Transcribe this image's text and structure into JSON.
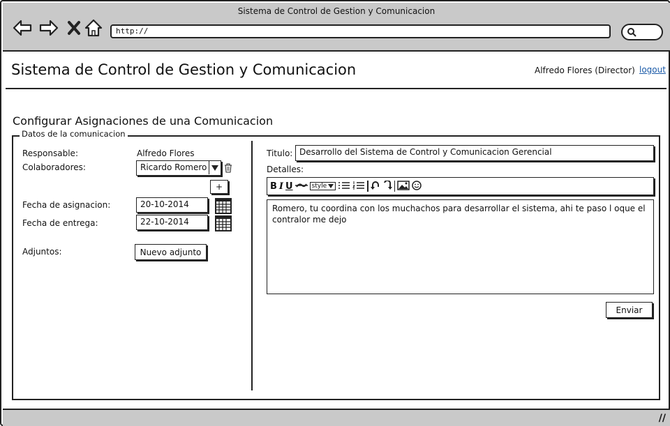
{
  "window": {
    "title": "Sistema de Control de Gestion y Comunicacion"
  },
  "browser": {
    "url": "http://"
  },
  "header": {
    "app_title": "Sistema de Control de Gestion y Comunicacion",
    "user": "Alfredo Flores (Director)",
    "logout_label": "logout"
  },
  "page": {
    "section_title": "Configurar Asignaciones de una Comunicacion",
    "group_label": "Datos de la comunicacion"
  },
  "left": {
    "responsable_label": "Responsable:",
    "responsable_value": "Alfredo Flores",
    "colaboradores_label": "Colaboradores:",
    "colaboradores_value": "Ricardo Romero",
    "add_label": "+",
    "fecha_asignacion_label": "Fecha de asignacion:",
    "fecha_asignacion_value": "20-10-2014",
    "fecha_entrega_label": "Fecha de entrega:",
    "fecha_entrega_value": "22-10-2014",
    "adjuntos_label": "Adjuntos:",
    "nuevo_adjunto_label": "Nuevo adjunto"
  },
  "right": {
    "titulo_label": "Titulo:",
    "titulo_value": "Desarrollo del Sistema de Control y Comunicacion Gerencial",
    "detalles_label": "Detalles:",
    "toolbar": {
      "bold": "B",
      "italic": "I",
      "underline": "U",
      "style": "style"
    },
    "detalles_value": "Romero, tu coordina con los muchachos para desarrollar el sistema, ahi te paso l oque el contralor me dejo",
    "enviar_label": "Enviar"
  },
  "colors": {
    "chrome": "#c9c9c9",
    "stroke": "#222222",
    "link": "#1a5aa8"
  },
  "icons": [
    "back-arrow-icon",
    "forward-arrow-icon",
    "close-icon",
    "home-icon",
    "search-icon",
    "dropdown-arrow-icon",
    "trash-icon",
    "calendar-icon",
    "bullet-list-icon",
    "numbered-list-icon",
    "undo-icon",
    "redo-icon",
    "image-icon",
    "smiley-icon",
    "resize-grip-icon"
  ]
}
